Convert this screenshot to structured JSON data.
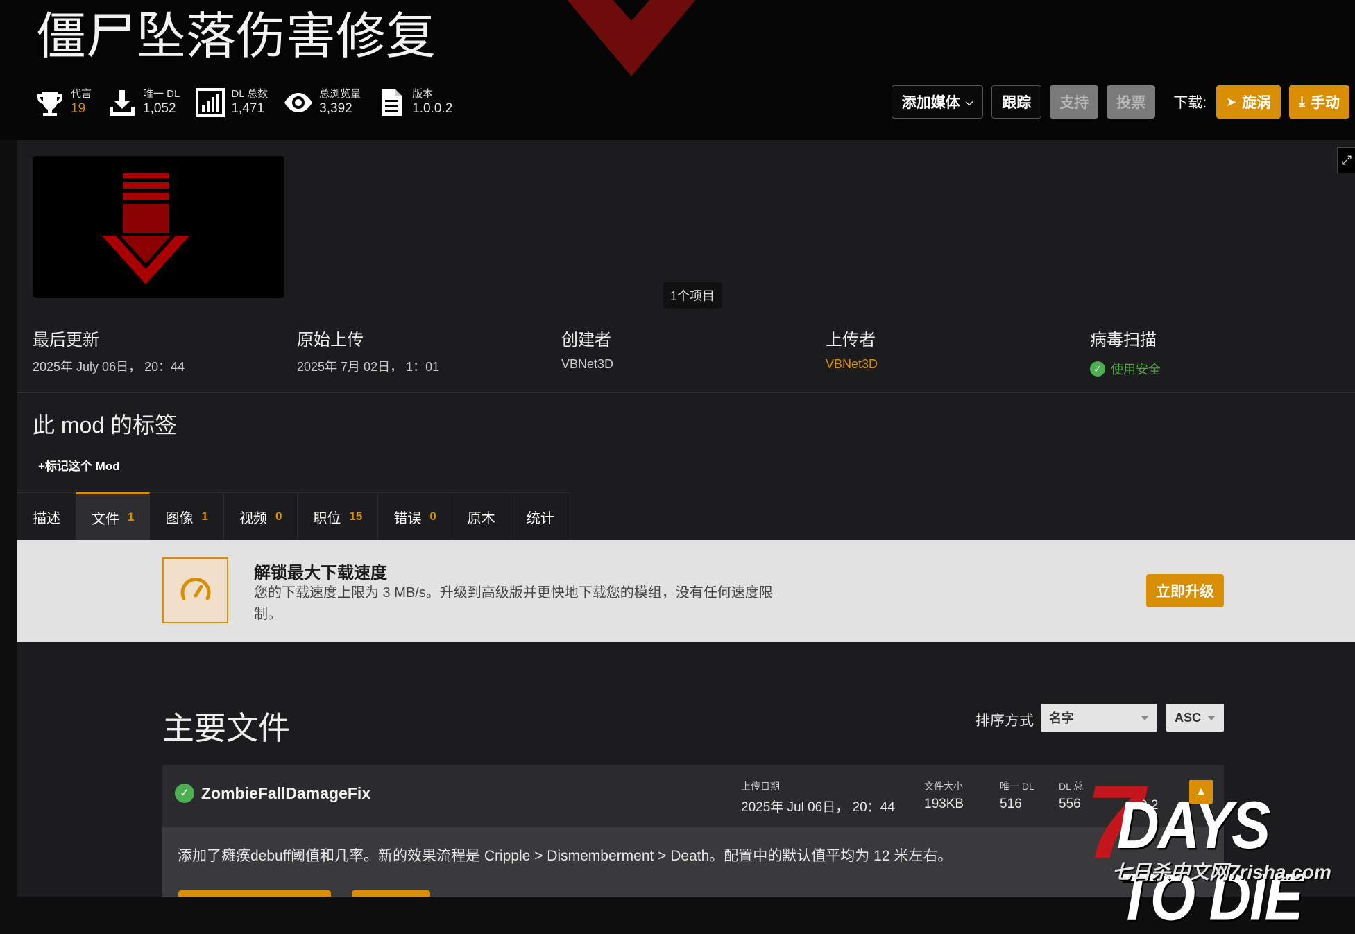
{
  "header": {
    "title": "僵尸坠落伤害修复",
    "stats": [
      {
        "label": "代言",
        "value": "19",
        "icon": "trophy-icon"
      },
      {
        "label": "唯一 DL",
        "value": "1,052",
        "icon": "download-icon"
      },
      {
        "label": "DL 总数",
        "value": "1,471",
        "icon": "bar-chart-icon"
      },
      {
        "label": "总浏览量",
        "value": "3,392",
        "icon": "eye-icon"
      },
      {
        "label": "版本",
        "value": "1.0.0.2",
        "icon": "document-icon"
      }
    ],
    "actions": {
      "add_media": "添加媒体",
      "track": "跟踪",
      "support": "支持",
      "vote": "投票",
      "download_label": "下载:",
      "vortex": "旋涡",
      "manual": "手动"
    }
  },
  "gallery": {
    "items_count": "1个项目"
  },
  "meta": {
    "last_updated": {
      "label": "最后更新",
      "value": "2025年 July 06日， 20：44"
    },
    "original_upload": {
      "label": "原始上传",
      "value": "2025年 7月 02日， 1：01"
    },
    "creator": {
      "label": "创建者",
      "value": "VBNet3D"
    },
    "uploader": {
      "label": "上传者",
      "value": "VBNet3D"
    },
    "virus_scan": {
      "label": "病毒扫描",
      "value": "使用安全"
    }
  },
  "tags": {
    "title": "此 mod 的标签",
    "tag_button": "+标记这个 Mod"
  },
  "tabs": [
    {
      "label": "描述",
      "count": ""
    },
    {
      "label": "文件",
      "count": "1"
    },
    {
      "label": "图像",
      "count": "1"
    },
    {
      "label": "视频",
      "count": "0"
    },
    {
      "label": "职位",
      "count": "15"
    },
    {
      "label": "错误",
      "count": "0"
    },
    {
      "label": "原木",
      "count": ""
    },
    {
      "label": "统计",
      "count": ""
    }
  ],
  "promo": {
    "title": "解锁最大下载速度",
    "text": "您的下载速度上限为 3 MB/s。升级到高级版并更快地下载您的模组，没有任何速度限制。",
    "button": "立即升级"
  },
  "files": {
    "title": "主要文件",
    "sort_label": "排序方式",
    "sort_by": "名字",
    "sort_order": "ASC",
    "items": [
      {
        "name": "ZombieFallDamageFix",
        "upload_date_label": "上传日期",
        "upload_date": "2025年 Jul 06日， 20：44",
        "size_label": "文件大小",
        "size": "193KB",
        "unique_dl_label": "唯一 DL",
        "unique_dl": "516",
        "total_dl_label": "DL 总",
        "total_dl": "556",
        "version": "0.2",
        "description": "添加了瘫痪debuff阈值和几率。新的效果流程是 Cripple > Dismemberment > Death。配置中的默认值平均为 12 米左右。"
      }
    ]
  },
  "watermark": {
    "brand": "DAYS TO DIE",
    "seven": "7",
    "sub": "七日杀中文网7risha.com"
  },
  "colors": {
    "accent": "#d98e04",
    "safe": "#4caf50",
    "banner_red": "#8b0000"
  }
}
